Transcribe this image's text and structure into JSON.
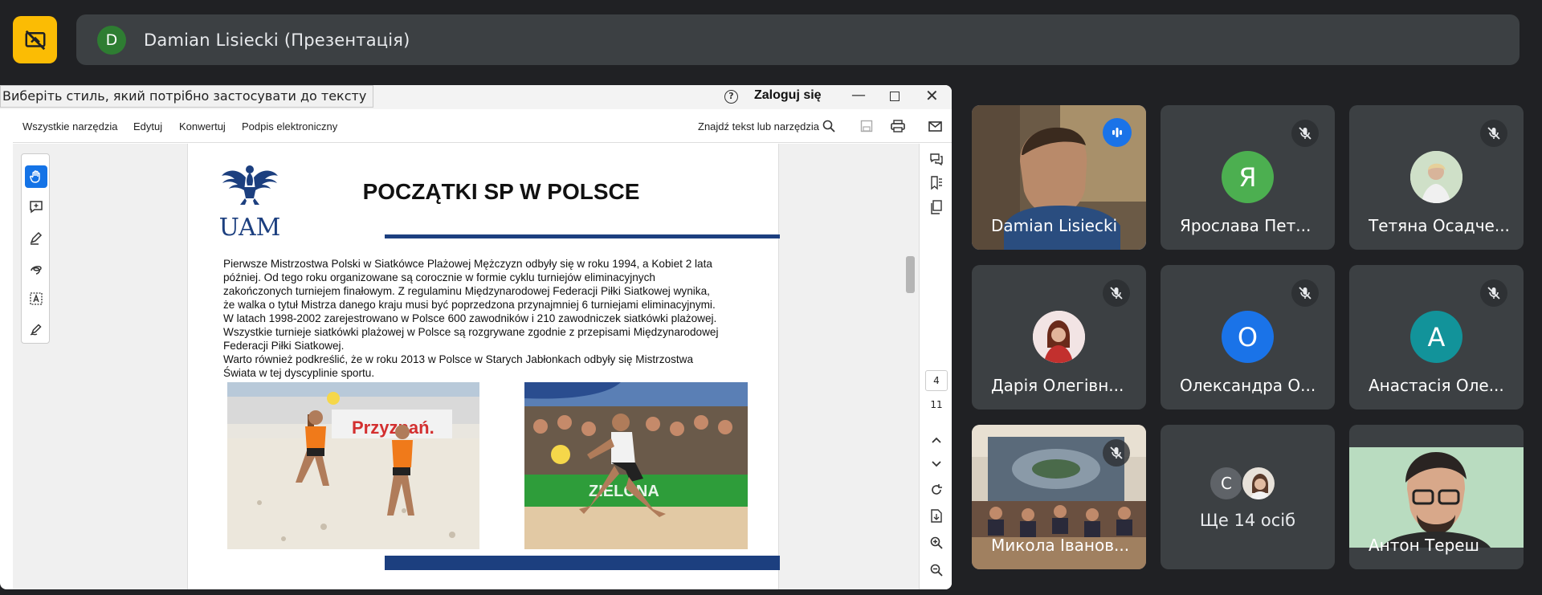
{
  "meeting": {
    "presenter_initial": "D",
    "presenter_label": "Damian Lisiecki (Презентація)"
  },
  "tooltip": "Виберіть стиль, який потрібно застосувати до тексту",
  "acrobat": {
    "help": "?",
    "login": "Zaloguj się",
    "menu": [
      "Wszystkie narzędzia",
      "Edytuj",
      "Konwertuj",
      "Podpis elektroniczny"
    ],
    "find": "Znajdź tekst lub narzędzia",
    "page_current": "4",
    "page_total": "11"
  },
  "slide": {
    "logo_text": "UAM",
    "title": "POCZĄTKI SP W POLSCE",
    "paragraph_lines": [
      "Pierwsze Mistrzostwa Polski w Siatkówce Plażowej Mężczyzn odbyły się w roku 1994, a Kobiet 2 lata",
      "później. Od tego roku organizowane są corocznie w formie cyklu turniejów eliminacyjnych",
      "zakończonych turniejem finałowym. Z regulaminu Międzynarodowej Federacji Piłki Siatkowej wynika,",
      "że  walka o tytuł Mistrza danego kraju musi być poprzedzona przynajmniej 6 turniejami eliminacyjnymi.",
      "W latach 1998-2002 zarejestrowano w Polsce 600 zawodników i 210 zawodniczek siatkówki plażowej.",
      "Wszystkie turnieje siatkówki plażowej w Polsce są rozgrywane zgodnie z przepisami Międzynarodowej",
      "Federacji  Piłki Siatkowej.",
      "Warto również podkreślić, że w roku 2013 w Polsce w Starych Jabłonkach odbyły się Mistrzostwa",
      "Świata w tej dyscyplinie sportu."
    ],
    "photo1_banner": "Przyznań.",
    "photo2_banner": "ZIELONA"
  },
  "participants": [
    {
      "name": "Damian Lisiecki",
      "type": "video",
      "speaking": true
    },
    {
      "name": "Ярослава Пет...",
      "initial": "Я",
      "color": "#4caf50",
      "muted": true
    },
    {
      "name": "Тетяна Осадче...",
      "type": "photo",
      "muted": true
    },
    {
      "name": "Дарія Олегівн...",
      "type": "photo",
      "muted": true
    },
    {
      "name": "Олександра О...",
      "initial": "О",
      "color": "#1a73e8",
      "muted": true
    },
    {
      "name": "Анастасія Оле...",
      "initial": "А",
      "color": "#12939a",
      "muted": true
    },
    {
      "name": "Микола Іванов...",
      "type": "video",
      "muted": true
    },
    {
      "more_initial": "С",
      "more_label": "Ще 14 осіб"
    },
    {
      "name": "Антон Тереш",
      "type": "video"
    }
  ]
}
